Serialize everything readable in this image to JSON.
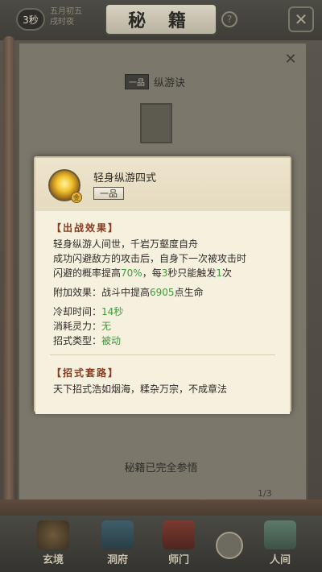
{
  "header": {
    "timer": "3秒",
    "time_info_line1": "五月初五",
    "time_info_line2": "戌时夜",
    "title": "秘 籍",
    "help_icon": "question-icon",
    "close_icon": "close-icon"
  },
  "background": {
    "skill_grade": "一品",
    "skill_name": "纵游诀",
    "completed_text": "秘籍已完全参悟",
    "page_indicator": "1/3"
  },
  "tooltip": {
    "title": "轻身纵游四式",
    "grade": "一品",
    "icon_badge": "金",
    "battle_heading": "【出战效果】",
    "battle_lines": [
      "轻身纵游人间世，千岩万壑度自舟",
      "成功闪避敌方的攻击后，自身下一次被攻击时"
    ],
    "prob_prefix": "闪避的概率提高",
    "prob_value": "70%",
    "prob_mid": "，每",
    "prob_secs": "3",
    "prob_mid2": "秒只能触发",
    "prob_times": "1",
    "prob_suffix": "次",
    "extra_prefix": "附加效果：战斗中提高",
    "extra_value": "6905",
    "extra_suffix": "点生命",
    "cooldown_label": "冷却时间：",
    "cooldown_value": "14秒",
    "cost_label": "消耗灵力：",
    "cost_value": "无",
    "type_label": "招式类型：",
    "type_value": "被动",
    "set_heading": "【招式套路】",
    "set_line": "天下招式浩如烟海，糅杂万宗，不成章法"
  },
  "nav": {
    "items": [
      {
        "label": "玄境"
      },
      {
        "label": "洞府"
      },
      {
        "label": "师门"
      },
      {
        "label": "人间"
      }
    ]
  },
  "colors": {
    "accent_red": "#8a3a1c",
    "highlight_green": "#3f9a3a",
    "card_bg": "#f6f0df"
  }
}
